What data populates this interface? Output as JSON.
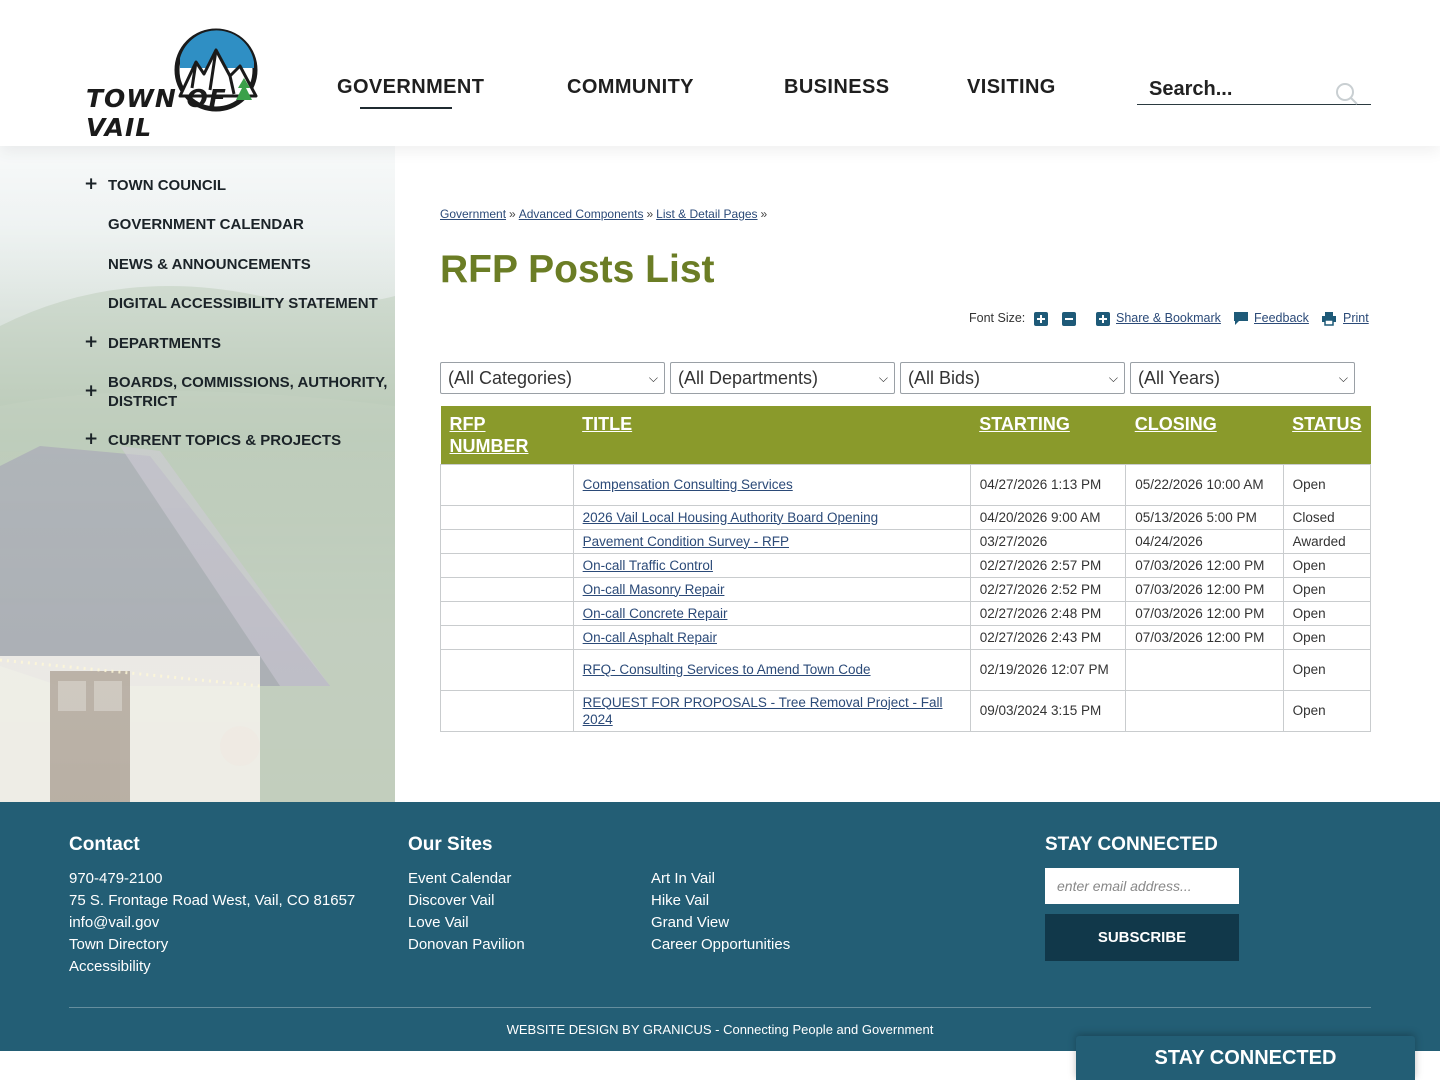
{
  "header": {
    "logo_text": "TOWN OF VAIL",
    "nav": [
      "GOVERNMENT",
      "COMMUNITY",
      "BUSINESS",
      "VISITING"
    ],
    "search_placeholder": "Search..."
  },
  "sidebar": {
    "items": [
      {
        "label": "TOWN COUNCIL",
        "expandable": true
      },
      {
        "label": "GOVERNMENT CALENDAR",
        "expandable": false
      },
      {
        "label": "NEWS & ANNOUNCEMENTS",
        "expandable": false
      },
      {
        "label": "DIGITAL ACCESSIBILITY STATEMENT",
        "expandable": false
      },
      {
        "label": "DEPARTMENTS",
        "expandable": true
      },
      {
        "label": "BOARDS, COMMISSIONS, AUTHORITY, DISTRICT",
        "expandable": true
      },
      {
        "label": "CURRENT TOPICS & PROJECTS",
        "expandable": true
      }
    ],
    "plus_symbol": "+"
  },
  "breadcrumb": {
    "items": [
      "Government",
      "Advanced Components",
      "List & Detail Pages"
    ],
    "separator": "»"
  },
  "page_title": "RFP Posts List",
  "tools": {
    "font_size_label": "Font Size:",
    "share": "Share & Bookmark",
    "feedback": "Feedback",
    "print": "Print"
  },
  "filters": [
    "(All Categories)",
    "(All Departments)",
    "(All Bids)",
    "(All Years)"
  ],
  "table": {
    "headers": [
      "RFP NUMBER",
      "TITLE",
      "STARTING",
      "CLOSING",
      "STATUS"
    ],
    "rows": [
      {
        "number": "",
        "title": "Compensation Consulting Services",
        "starting": "04/27/2026 1:13 PM",
        "closing": "05/22/2026 10:00 AM",
        "status": "Open"
      },
      {
        "number": "",
        "title": "2026 Vail Local Housing Authority Board Opening",
        "starting": "04/20/2026 9:00 AM",
        "closing": "05/13/2026 5:00 PM",
        "status": "Closed"
      },
      {
        "number": "",
        "title": "Pavement Condition Survey - RFP",
        "starting": "03/27/2026",
        "closing": "04/24/2026",
        "status": "Awarded"
      },
      {
        "number": "",
        "title": "On-call Traffic Control",
        "starting": "02/27/2026 2:57 PM",
        "closing": "07/03/2026 12:00 PM",
        "status": "Open"
      },
      {
        "number": "",
        "title": "On-call Masonry Repair",
        "starting": "02/27/2026 2:52 PM",
        "closing": "07/03/2026 12:00 PM",
        "status": "Open"
      },
      {
        "number": "",
        "title": "On-call Concrete Repair",
        "starting": "02/27/2026 2:48 PM",
        "closing": "07/03/2026 12:00 PM",
        "status": "Open"
      },
      {
        "number": "",
        "title": "On-call Asphalt Repair",
        "starting": "02/27/2026 2:43 PM",
        "closing": "07/03/2026 12:00 PM",
        "status": "Open"
      },
      {
        "number": "",
        "title": "RFQ- Consulting Services to Amend Town Code",
        "starting": "02/19/2026 12:07 PM",
        "closing": "",
        "status": "Open"
      },
      {
        "number": "",
        "title": "REQUEST FOR PROPOSALS - Tree Removal Project - Fall 2024",
        "starting": "09/03/2024 3:15 PM",
        "closing": "",
        "status": "Open"
      }
    ]
  },
  "footer": {
    "contact": {
      "heading": "Contact",
      "lines": [
        "970-479-2100",
        "75 S. Frontage Road West, Vail, CO 81657",
        "info@vail.gov",
        "Town Directory",
        "Accessibility"
      ]
    },
    "sites": {
      "heading": "Our Sites",
      "col1": [
        "Event Calendar",
        "Discover Vail",
        "Love Vail",
        "Donovan Pavilion"
      ],
      "col2": [
        "Art In Vail",
        "Hike Vail",
        "Grand View",
        "Career Opportunities"
      ]
    },
    "stay": {
      "heading": "STAY CONNECTED",
      "email_placeholder": "enter email address...",
      "subscribe": "SUBSCRIBE"
    },
    "credit": "WEBSITE DESIGN BY GRANICUS - Connecting People and Government"
  },
  "sticky_label": "STAY CONNECTED",
  "colors": {
    "accent_olive": "#8a9a2b",
    "title_olive": "#6b7d25",
    "footer_teal": "#235e75",
    "link_blue": "#2b4a78",
    "button_dark": "#11384a"
  }
}
